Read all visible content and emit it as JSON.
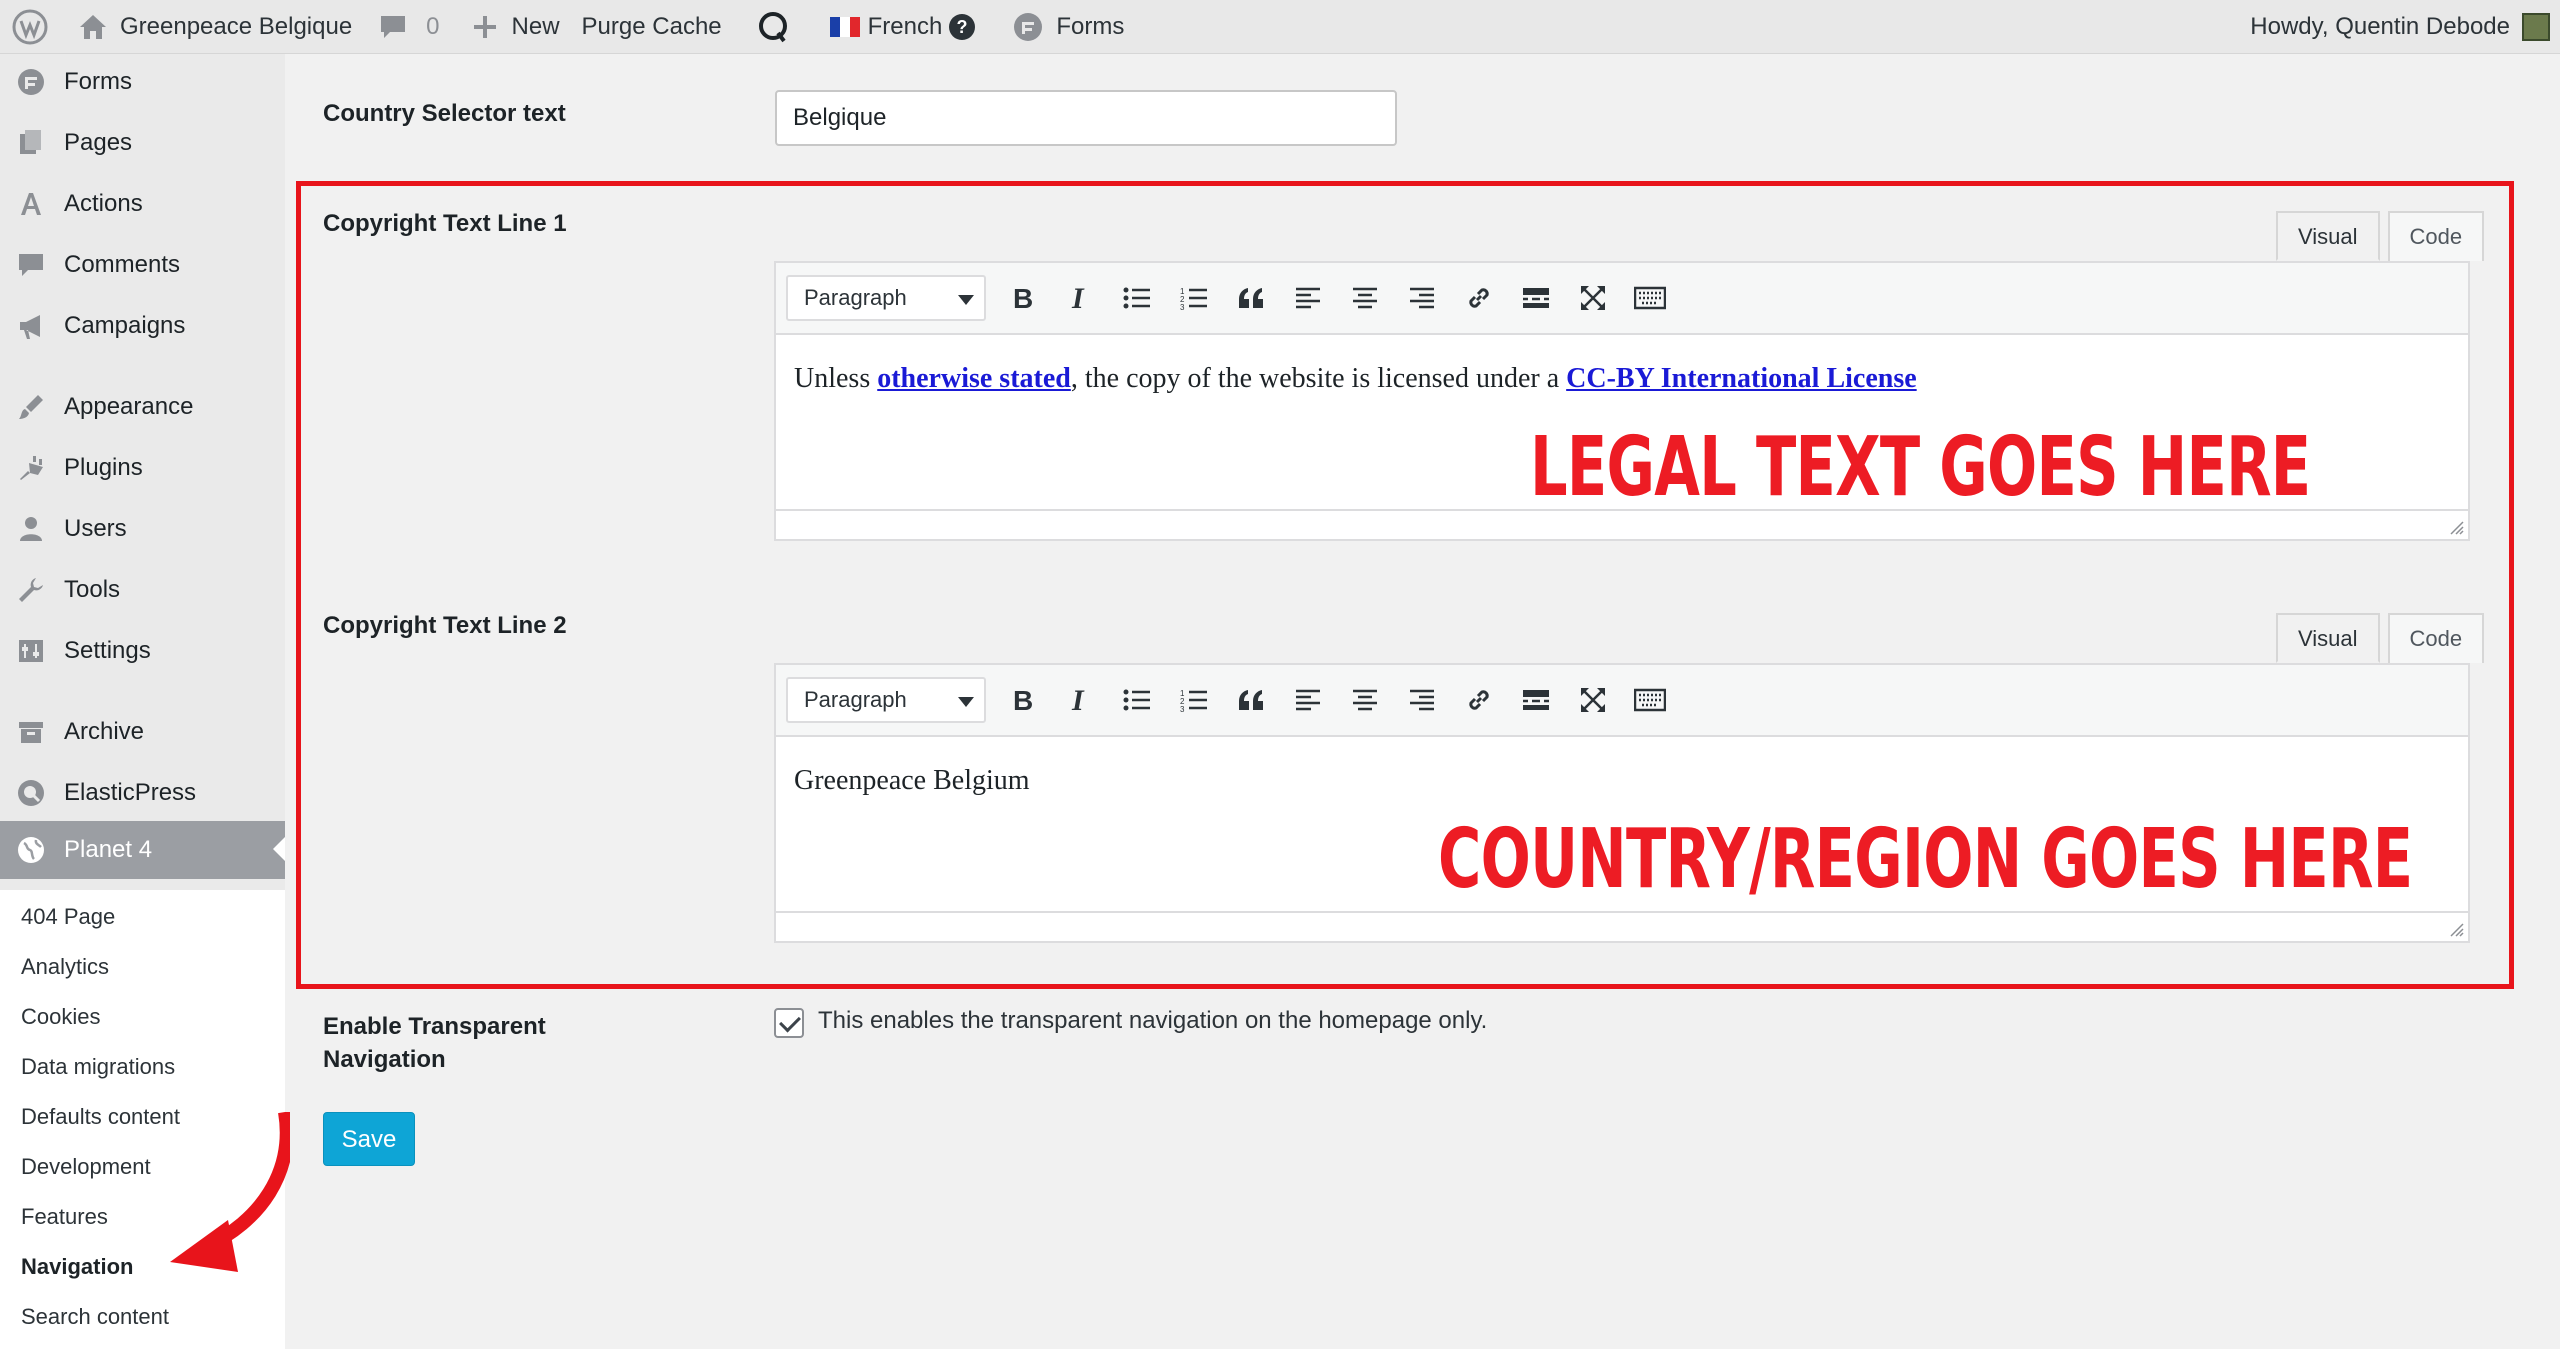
{
  "adminbar": {
    "site_name": "Greenpeace Belgique",
    "comments_count": "0",
    "new_label": "New",
    "purge_label": "Purge Cache",
    "language_label": "French",
    "forms_label": "Forms",
    "howdy": "Howdy, Quentin Debode"
  },
  "sidebar": {
    "items": [
      {
        "label": "Forms",
        "icon": "forms-icon"
      },
      {
        "label": "Pages",
        "icon": "pages-icon"
      },
      {
        "label": "Actions",
        "icon": "actions-icon"
      },
      {
        "label": "Comments",
        "icon": "comments-icon"
      },
      {
        "label": "Campaigns",
        "icon": "megaphone-icon"
      },
      {
        "label": "Appearance",
        "icon": "paintbrush-icon"
      },
      {
        "label": "Plugins",
        "icon": "plugins-icon"
      },
      {
        "label": "Users",
        "icon": "users-icon"
      },
      {
        "label": "Tools",
        "icon": "wrench-icon"
      },
      {
        "label": "Settings",
        "icon": "settings-icon"
      },
      {
        "label": "Archive",
        "icon": "archive-icon"
      },
      {
        "label": "ElasticPress",
        "icon": "elasticpress-icon"
      },
      {
        "label": "Planet 4",
        "icon": "globe-icon"
      }
    ],
    "submenu": [
      "404 Page",
      "Analytics",
      "Cookies",
      "Data migrations",
      "Defaults content",
      "Development",
      "Features",
      "Navigation",
      "Search content"
    ],
    "current_submenu": "Navigation"
  },
  "form": {
    "country_selector_label": "Country Selector text",
    "country_selector_value": "Belgique",
    "copyright1_label": "Copyright Text Line 1",
    "copyright2_label": "Copyright Text Line 2",
    "tab_visual": "Visual",
    "tab_code": "Code",
    "format_select": "Paragraph",
    "copyright1_text_before": "Unless ",
    "copyright1_link1": "otherwise stated",
    "copyright1_text_middle": ", the copy of the website is licensed under a ",
    "copyright1_link2": "CC-BY International License",
    "copyright2_text": "Greenpeace Belgium",
    "transparent_nav_label_line1": "Enable Transparent",
    "transparent_nav_label_line2": "Navigation",
    "transparent_nav_checked": true,
    "transparent_nav_desc": "This enables the transparent navigation on the homepage only.",
    "save_label": "Save"
  },
  "annotations": {
    "legal_text": "LEGAL TEXT GOES HERE",
    "country_text": "COUNTRY/REGION GOES HERE",
    "color": "#ed1c24"
  }
}
